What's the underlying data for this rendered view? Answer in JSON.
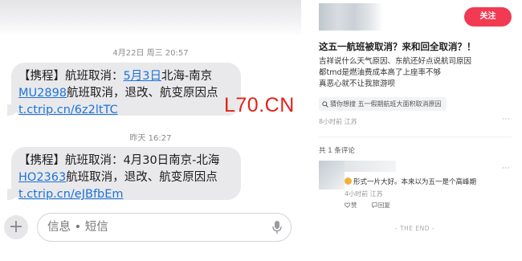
{
  "sms": {
    "messages": [
      {
        "timestamp": "4月22日 周三 20:57",
        "line1_prefix": "【携程】航班取消：",
        "line1_link": "5月3日",
        "line1_suffix": "北海-南京",
        "line2_link": "MU2898",
        "line2_suffix": "航班取消，退改、航变原因点",
        "line3_link": "t.ctrip.cn/6z2ltTC"
      },
      {
        "timestamp": "昨天 16:27",
        "line1_text": "【携程】航班取消：4月30日南京-北海",
        "line2_link": "HO2363",
        "line2_suffix": "航班取消，退改、航变原因点",
        "line3_link": "t.ctrip.cn/eJBfbEm"
      }
    ],
    "watermark": "L70.CN",
    "composer": {
      "plus_label": "+",
      "placeholder": "信息 • 短信",
      "mic_icon": "mic-icon"
    }
  },
  "post": {
    "follow_label": "关注",
    "title": "这五一航班被取消？来和回全取消？！",
    "body": [
      "吉祥说什么天气原因、东航还好点说航司原因",
      "都tmd是燃油费成本高了上座率不够",
      "真恶心就不让我旅游呗"
    ],
    "tag": "猜你想搜  五一假期航班大面积取消原因",
    "meta": "8小时前  江苏",
    "comment_count": "共 1 条评论",
    "comment": {
      "text": "形式一片大好。本来以为五一是个高峰期",
      "meta": "4小时前  江苏",
      "like_label": "赞",
      "reply_label": "回复"
    },
    "end_text": "- THE END -"
  },
  "colors": {
    "link": "#1d73d9",
    "bubble": "#e9e9eb",
    "watermark": "#e2231a",
    "follow_button": "#f23a53"
  }
}
